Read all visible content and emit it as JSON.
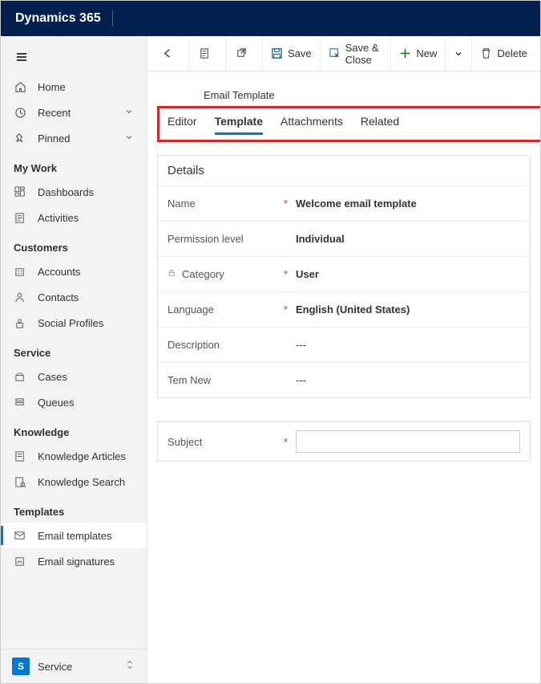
{
  "app_title": "Dynamics 365",
  "sidebar": {
    "top": [
      {
        "icon": "home",
        "label": "Home"
      },
      {
        "icon": "recent",
        "label": "Recent",
        "chev": true
      },
      {
        "icon": "pinned",
        "label": "Pinned",
        "chev": true
      }
    ],
    "groups": [
      {
        "title": "My Work",
        "items": [
          {
            "icon": "dashboard",
            "label": "Dashboards"
          },
          {
            "icon": "activities",
            "label": "Activities"
          }
        ]
      },
      {
        "title": "Customers",
        "items": [
          {
            "icon": "accounts",
            "label": "Accounts"
          },
          {
            "icon": "contacts",
            "label": "Contacts"
          },
          {
            "icon": "social",
            "label": "Social Profiles"
          }
        ]
      },
      {
        "title": "Service",
        "items": [
          {
            "icon": "cases",
            "label": "Cases"
          },
          {
            "icon": "queues",
            "label": "Queues"
          }
        ]
      },
      {
        "title": "Knowledge",
        "items": [
          {
            "icon": "karticle",
            "label": "Knowledge Articles"
          },
          {
            "icon": "ksearch",
            "label": "Knowledge Search"
          }
        ]
      },
      {
        "title": "Templates",
        "items": [
          {
            "icon": "emailtpl",
            "label": "Email templates",
            "active": true
          },
          {
            "icon": "emailsig",
            "label": "Email signatures"
          }
        ]
      }
    ],
    "footer": {
      "badge": "S",
      "label": "Service"
    }
  },
  "commands": {
    "save": "Save",
    "save_close": "Save & Close",
    "new": "New",
    "delete": "Delete"
  },
  "form": {
    "entity": "Email Template",
    "tabs": [
      "Editor",
      "Template",
      "Attachments",
      "Related"
    ],
    "active_tab": "Template",
    "section_title": "Details",
    "fields": [
      {
        "label": "Name",
        "required": true,
        "value": "Welcome email template",
        "bold": true
      },
      {
        "label": "Permission level",
        "required": false,
        "value": "Individual",
        "bold": true
      },
      {
        "label": "Category",
        "required": true,
        "value": "User",
        "bold": true,
        "locked": true
      },
      {
        "label": "Language",
        "required": true,
        "value": "English (United States)",
        "bold": true
      },
      {
        "label": "Description",
        "required": false,
        "value": "---"
      },
      {
        "label": "Tem New",
        "required": false,
        "value": "---"
      }
    ],
    "subject_label": "Subject",
    "subject_value": ""
  }
}
